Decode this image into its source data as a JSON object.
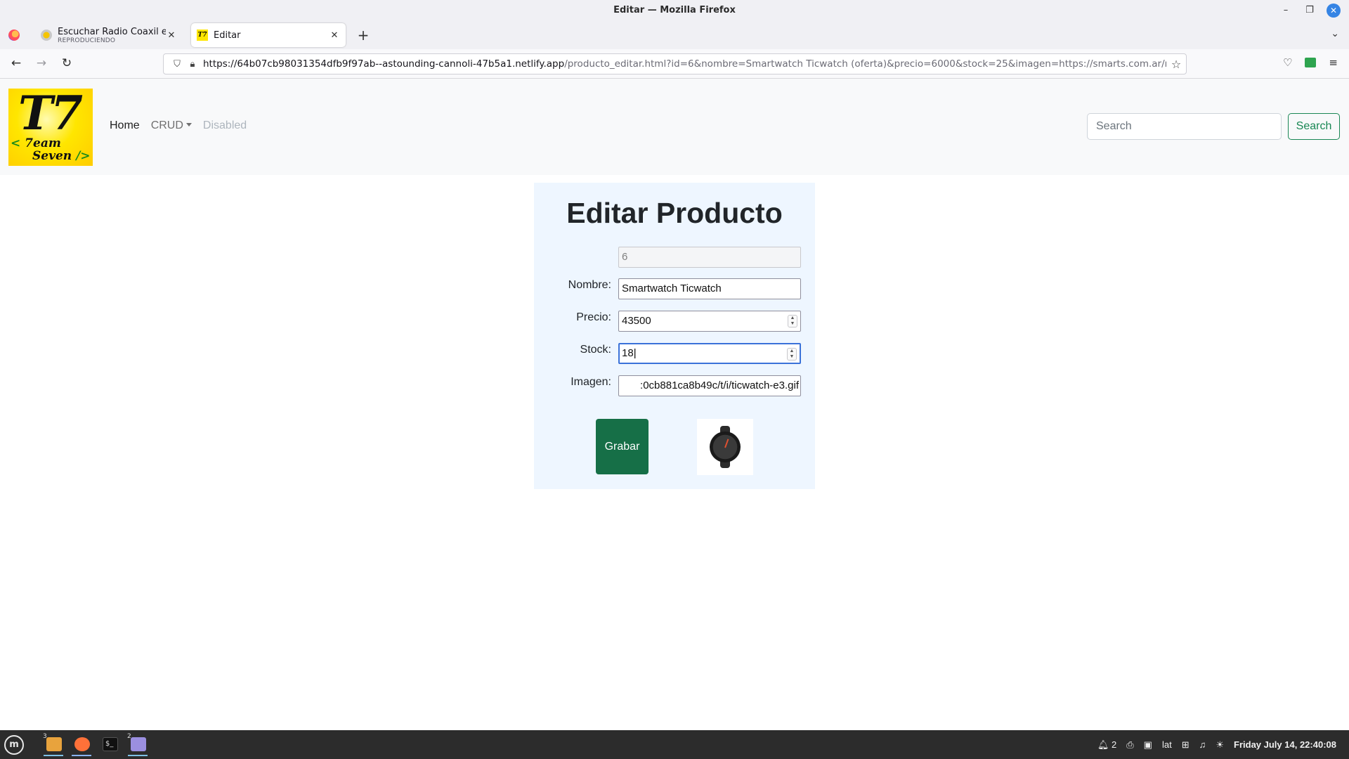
{
  "window": {
    "title": "Editar — Mozilla Firefox"
  },
  "tabs": [
    {
      "title": "Escuchar Radio Coaxil en vi",
      "subtitle": "REPRODUCIENDO",
      "favicon": "radio-favicon-icon"
    },
    {
      "title": "Editar",
      "favicon": "t7-favicon-icon"
    }
  ],
  "urlbar": {
    "host": "https://64b07cb98031354dfb9f97ab--astounding-cannoli-47b5a1.netlify.app",
    "path": "/producto_editar.html?id=6&nombre=Smartwatch Ticwatch (oferta)&precio=6000&stock=25&imagen=https://smarts.com.ar/media/catalog"
  },
  "site": {
    "logo": {
      "big": "T7",
      "line1_prefix": "< ",
      "line1": "7eam",
      "line2": "Seven",
      "line2_suffix": " />"
    },
    "nav": {
      "home": "Home",
      "crud": "CRUD",
      "disabled": "Disabled"
    },
    "search": {
      "placeholder": "Search",
      "button": "Search"
    }
  },
  "form": {
    "heading": "Editar Producto",
    "id_value": "6",
    "fields": {
      "nombre": {
        "label": "Nombre:",
        "value": "Smartwatch Ticwatch"
      },
      "precio": {
        "label": "Precio:",
        "value": "43500"
      },
      "stock": {
        "label": "Stock:",
        "value": "18"
      },
      "imagen": {
        "label": "Imagen:",
        "value": ":0cb881ca8b49c/t/i/ticwatch-e3.gif"
      }
    },
    "submit_label": "Grabar"
  },
  "taskbar": {
    "file_manager_badge": "3",
    "text_editor_badge": "2",
    "notifications_count": "2",
    "keyboard_layout": "lat",
    "clock": "Friday July 14, 22:40:08"
  },
  "colors": {
    "accent_green": "#198754",
    "grabar_bg": "#166f47",
    "panel_bg": "#eef6ff",
    "focus_blue": "#3b72d9"
  }
}
